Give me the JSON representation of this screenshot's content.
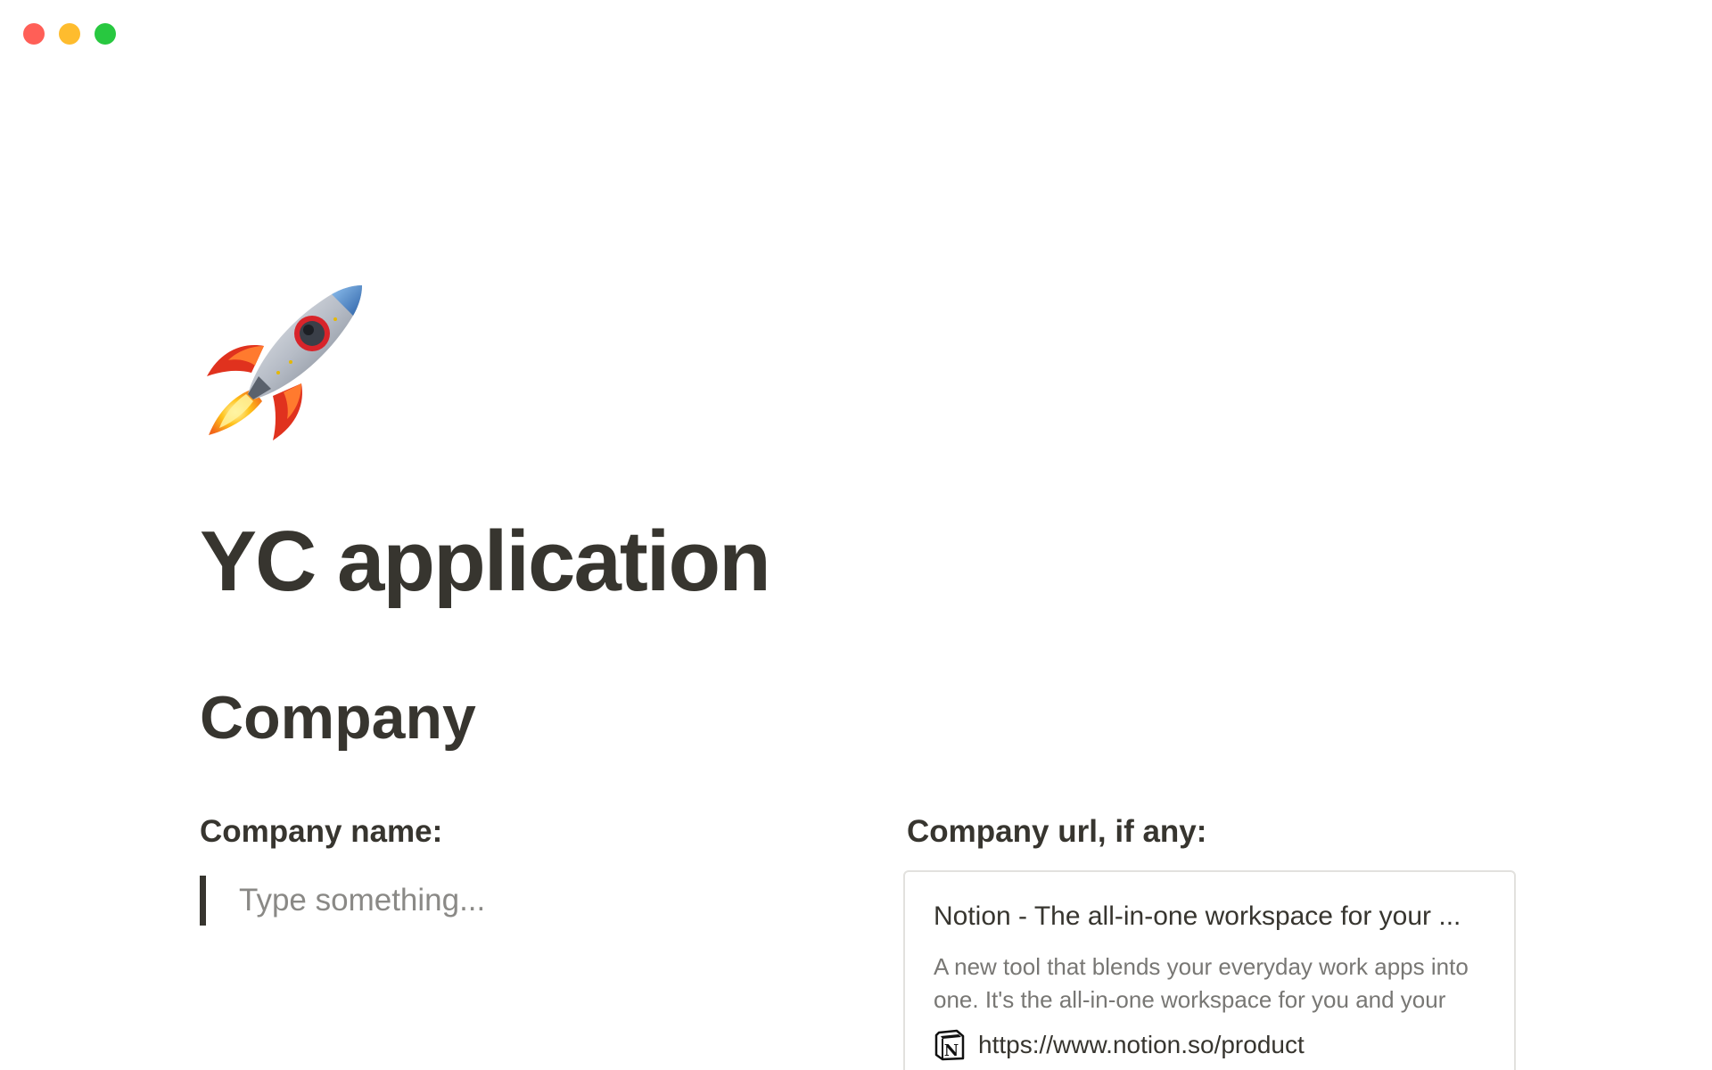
{
  "window": {
    "controls": [
      "close",
      "minimize",
      "maximize"
    ]
  },
  "page": {
    "icon": "rocket-icon",
    "title": "YC application"
  },
  "section": {
    "heading": "Company"
  },
  "company_name": {
    "label": "Company name:",
    "placeholder": "Type something..."
  },
  "company_url": {
    "label": "Company url, if any:",
    "bookmark": {
      "title": "Notion - The all-in-one workspace for your ...",
      "description": "A new tool that blends your everyday work apps into one. It's the all-in-one workspace for you and your",
      "icon": "notion-logo-icon",
      "url": "https://www.notion.so/product"
    }
  },
  "colors": {
    "text": "#37352f",
    "placeholder": "#8a8986",
    "muted": "#787774",
    "close": "#ff5f57",
    "minimize": "#febc2e",
    "maximize": "#28c840"
  }
}
